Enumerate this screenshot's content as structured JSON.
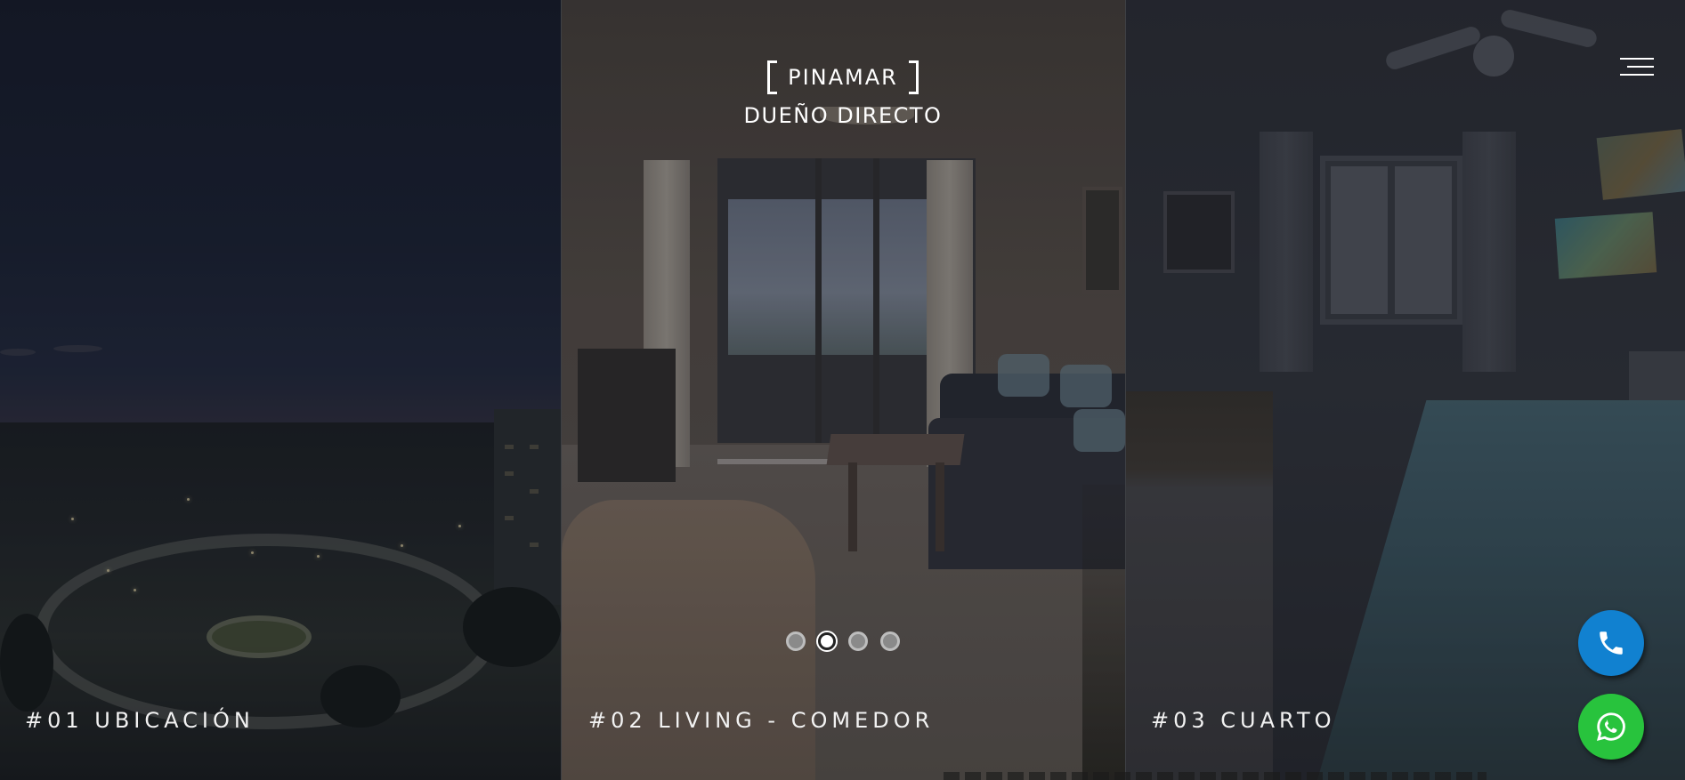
{
  "brand": {
    "name": "PINAMAR",
    "subtitle": "DUEÑO DIRECTO"
  },
  "panels": [
    {
      "caption": "#01 UBICACIÓN",
      "image": "night-city-aerial-photo"
    },
    {
      "caption": "#02 LIVING - COMEDOR",
      "image": "living-room-photo"
    },
    {
      "caption": "#03 CUARTO",
      "image": "bedroom-photo"
    }
  ],
  "slider": {
    "dots": 4,
    "active_index": 1
  },
  "icons": {
    "menu": "hamburger-menu-icon",
    "phone": "phone-icon",
    "whatsapp": "whatsapp-icon"
  },
  "colors": {
    "phone_button": "#1181d0",
    "whatsapp_button": "#28c33d",
    "text": "#ffffff"
  }
}
